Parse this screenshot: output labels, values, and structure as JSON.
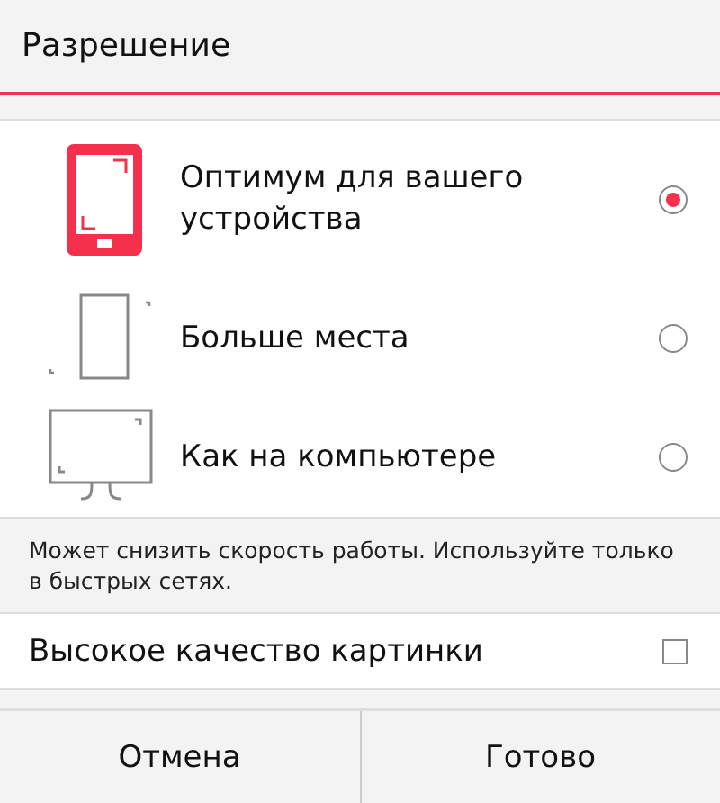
{
  "title": "Разрешение",
  "options": [
    {
      "kind": "phone",
      "label": "Оптимум для вашего устройства",
      "selected": true
    },
    {
      "kind": "tablet",
      "label": "Больше места",
      "selected": false
    },
    {
      "kind": "monitor",
      "label": "Как на компьютере",
      "selected": false
    }
  ],
  "note": "Может снизить скорость работы. Используйте только в быстрых сетях.",
  "hq": {
    "label": "Высокое качество картинки",
    "checked": false
  },
  "buttons": [
    "Отмена",
    "Готово"
  ]
}
